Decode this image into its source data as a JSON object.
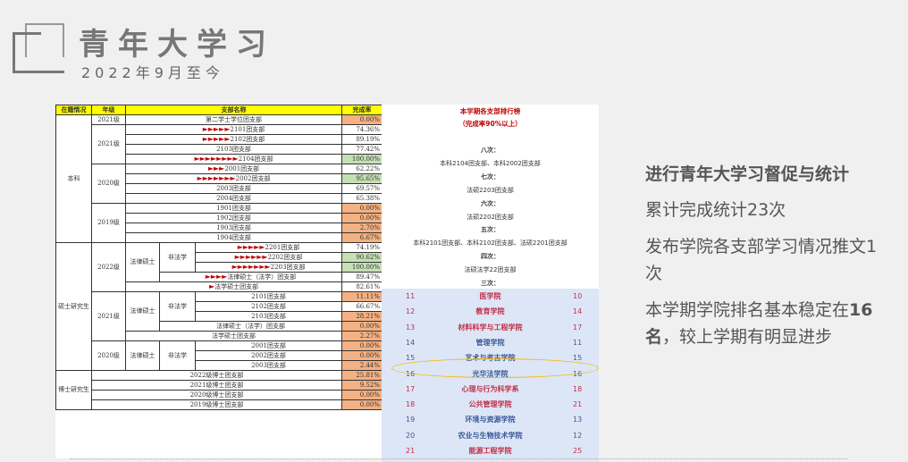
{
  "header": {
    "title": "青年大学习",
    "subtitle": "2022年9月至今"
  },
  "table": {
    "headers": [
      "在籍情况",
      "年级",
      "支部名称",
      "完成率"
    ],
    "status": {
      "undergrad": "本科",
      "master": "硕士研究生",
      "phd": "博士研究生"
    },
    "grades": {
      "g2021a": "2021级",
      "g2021b": "2021级",
      "g2020": "2020级",
      "g2019": "2019级",
      "g2022": "2022级",
      "m2021": "2021级",
      "m2020": "2020级"
    },
    "subgroups": {
      "lm1": "法律硕士",
      "nf1": "非法学",
      "lm2": "法律硕士",
      "nf2": "非法学",
      "lm3": "法律硕士",
      "nf3": "非法学"
    },
    "rows": [
      {
        "name": "第二学士学位团支部",
        "arrows": "",
        "rate": "0.00%"
      },
      {
        "name": "2101团支部",
        "arrows": "►►►►►",
        "rate": "74.36%"
      },
      {
        "name": "2102团支部",
        "arrows": "►►►►►",
        "rate": "89.19%"
      },
      {
        "name": "2103团支部",
        "arrows": "",
        "rate": "77.42%"
      },
      {
        "name": "2104团支部",
        "arrows": "►►►►►►►►",
        "rate": "100.00%"
      },
      {
        "name": "2001团支部",
        "arrows": "►►►",
        "rate": "62.22%"
      },
      {
        "name": "2002团支部",
        "arrows": "►►►►►►►",
        "rate": "95.65%"
      },
      {
        "name": "2003团支部",
        "arrows": "",
        "rate": "69.57%"
      },
      {
        "name": "2004团支部",
        "arrows": "",
        "rate": "65.38%"
      },
      {
        "name": "1901团支部",
        "arrows": "",
        "rate": "0.00%"
      },
      {
        "name": "1902团支部",
        "arrows": "",
        "rate": "0.00%"
      },
      {
        "name": "1903团支部",
        "arrows": "",
        "rate": "2.70%"
      },
      {
        "name": "1904团支部",
        "arrows": "",
        "rate": "6.67%"
      },
      {
        "name": "2201团支部",
        "arrows": "►►►►►",
        "rate": "74.19%"
      },
      {
        "name": "2202团支部",
        "arrows": "►►►►►►",
        "rate": "90.62%"
      },
      {
        "name": "2203团支部",
        "arrows": "►►►►►►►",
        "rate": "100.00%"
      },
      {
        "name": "法律硕士（法学）团支部",
        "arrows": "►►►►",
        "rate": "89.47%"
      },
      {
        "name": "法学硕士团支部",
        "arrows": "►",
        "rate": "82.61%"
      },
      {
        "name": "2101团支部",
        "arrows": "",
        "rate": "11.11%"
      },
      {
        "name": "2102团支部",
        "arrows": "",
        "rate": "66.67%"
      },
      {
        "name": "2103团支部",
        "arrows": "",
        "rate": "28.21%"
      },
      {
        "name": "法律硕士（法学）团支部",
        "arrows": "",
        "rate": "0.00%"
      },
      {
        "name": "法学硕士团支部",
        "arrows": "",
        "rate": "2.27%"
      },
      {
        "name": "2001团支部",
        "arrows": "",
        "rate": "0.00%"
      },
      {
        "name": "2002团支部",
        "arrows": "",
        "rate": "0.00%"
      },
      {
        "name": "2003团支部",
        "arrows": "",
        "rate": "2.44%"
      },
      {
        "name": "2022级博士团支部",
        "arrows": "",
        "rate": "25.81%"
      },
      {
        "name": "2021级博士团支部",
        "arrows": "",
        "rate": "9.52%"
      },
      {
        "name": "2020级博士团支部",
        "arrows": "",
        "rate": "0.00%"
      },
      {
        "name": "2019级博士团支部",
        "arrows": "",
        "rate": "0.00%"
      }
    ]
  },
  "ranking": {
    "title": "本学期各支部排行榜",
    "subtitle": "（完成率90%以上）",
    "l8": "八次：",
    "t8": "本科2104团支部、本科2002团支部",
    "l7": "七次：",
    "t7": "法硕2203团支部",
    "l6": "六次：",
    "t6": "法硕2202团支部",
    "l5": "五次：",
    "t5": "本科2101团支部、本科2102团支部、法硕2201团支部",
    "l4": "四次：",
    "t4": "法硕法学22团支部",
    "l3": "三次："
  },
  "college_list": [
    {
      "a": "11",
      "name": "医学院",
      "b": "10",
      "color": "red"
    },
    {
      "a": "12",
      "name": "教育学院",
      "b": "14",
      "color": "red"
    },
    {
      "a": "13",
      "name": "材料科学与工程学院",
      "b": "17",
      "color": "red"
    },
    {
      "a": "14",
      "name": "管理学院",
      "b": "11",
      "color": "blue"
    },
    {
      "a": "15",
      "name": "艺术与考古学院",
      "b": "15",
      "color": "blue"
    },
    {
      "a": "16",
      "name": "光华法学院",
      "b": "16",
      "color": "blue"
    },
    {
      "a": "17",
      "name": "心理与行为科学系",
      "b": "18",
      "color": "red"
    },
    {
      "a": "18",
      "name": "公共管理学院",
      "b": "21",
      "color": "red"
    },
    {
      "a": "19",
      "name": "环境与资源学院",
      "b": "13",
      "color": "blue"
    },
    {
      "a": "20",
      "name": "农业与生物技术学院",
      "b": "12",
      "color": "blue"
    },
    {
      "a": "21",
      "name": "能源工程学院",
      "b": "25",
      "color": "red"
    }
  ],
  "right_panel": {
    "p1": "进行青年大学习督促与统计",
    "p2": "累计完成统计23次",
    "p3": "发布学院各支部学习情况推文1次",
    "p4a": "本学期学院排名基本稳定在",
    "p4b": "16名",
    "p4c": "，较上学期有明显进步"
  }
}
